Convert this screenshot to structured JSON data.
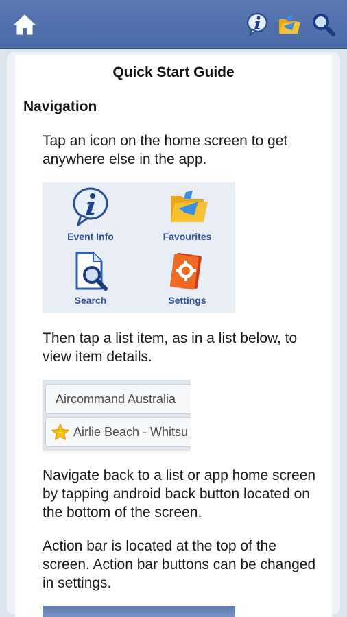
{
  "action_bar": {
    "icons": [
      "home-icon",
      "info-icon",
      "favourites-icon",
      "search-icon"
    ],
    "color": "#4f6ea9"
  },
  "guide": {
    "title": "Quick Start Guide",
    "section_heading": "Navigation",
    "para_1": "Tap an icon on the home screen to get anywhere else in the app.",
    "para_2": "Then tap a list item, as in a list below, to view item details.",
    "para_3": "Navigate back to a list or app home screen by tapping android back button located on the bottom of the screen.",
    "para_4": "Action bar is located at the top of the screen. Action bar buttons can be changed in settings."
  },
  "icon_grid": {
    "event_info": "Event Info",
    "favourites": "Favourites",
    "search": "Search",
    "settings": "Settings"
  },
  "list_example": {
    "item_1": "Aircommand Australia",
    "item_2": "Airlie Beach - Whitsu"
  }
}
